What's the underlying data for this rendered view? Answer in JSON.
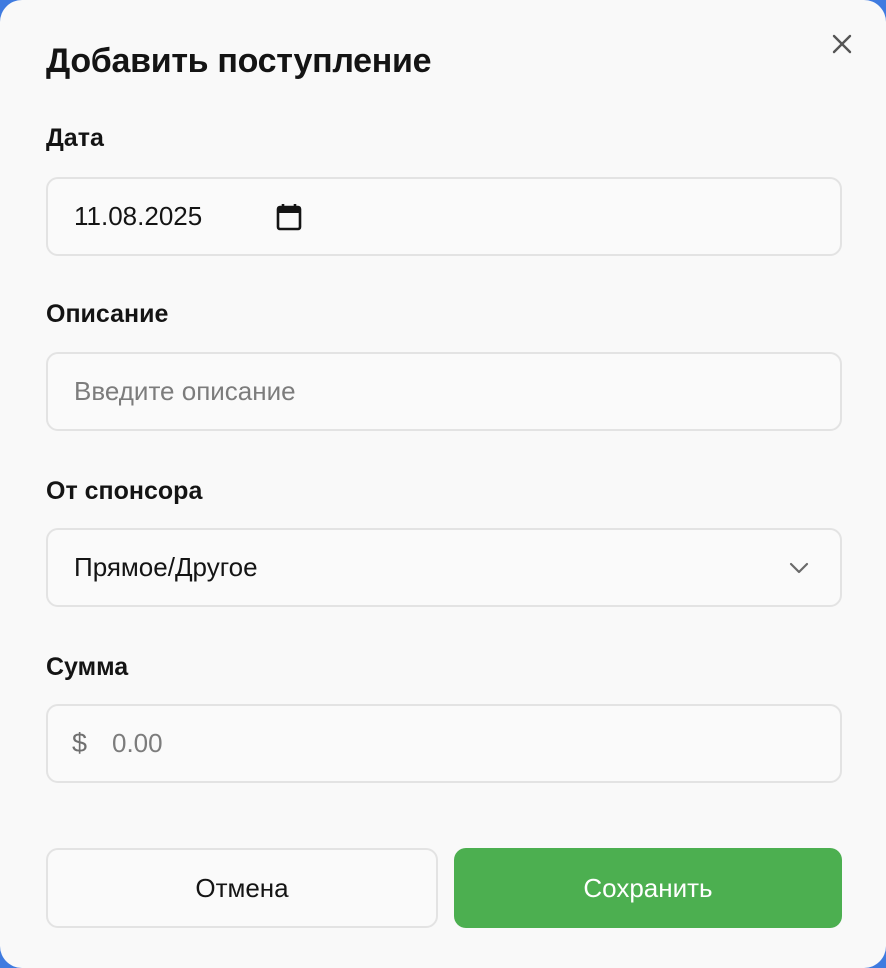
{
  "dialog": {
    "title": "Добавить поступление",
    "close_icon": "close-icon"
  },
  "date": {
    "label": "Дата",
    "value": "11.08.2025",
    "icon": "calendar-icon"
  },
  "description": {
    "label": "Описание",
    "value": "",
    "placeholder": "Введите описание"
  },
  "sponsor": {
    "label": "От спонсора",
    "selected": "Прямое/Другое",
    "icon": "chevron-down-icon"
  },
  "amount": {
    "label": "Сумма",
    "currency": "$",
    "value": "",
    "placeholder": "0.00"
  },
  "actions": {
    "cancel_label": "Отмена",
    "save_label": "Сохранить"
  },
  "colors": {
    "primary": "#4caf50",
    "border": "#e3e3e3",
    "background": "#f9f9f9"
  }
}
